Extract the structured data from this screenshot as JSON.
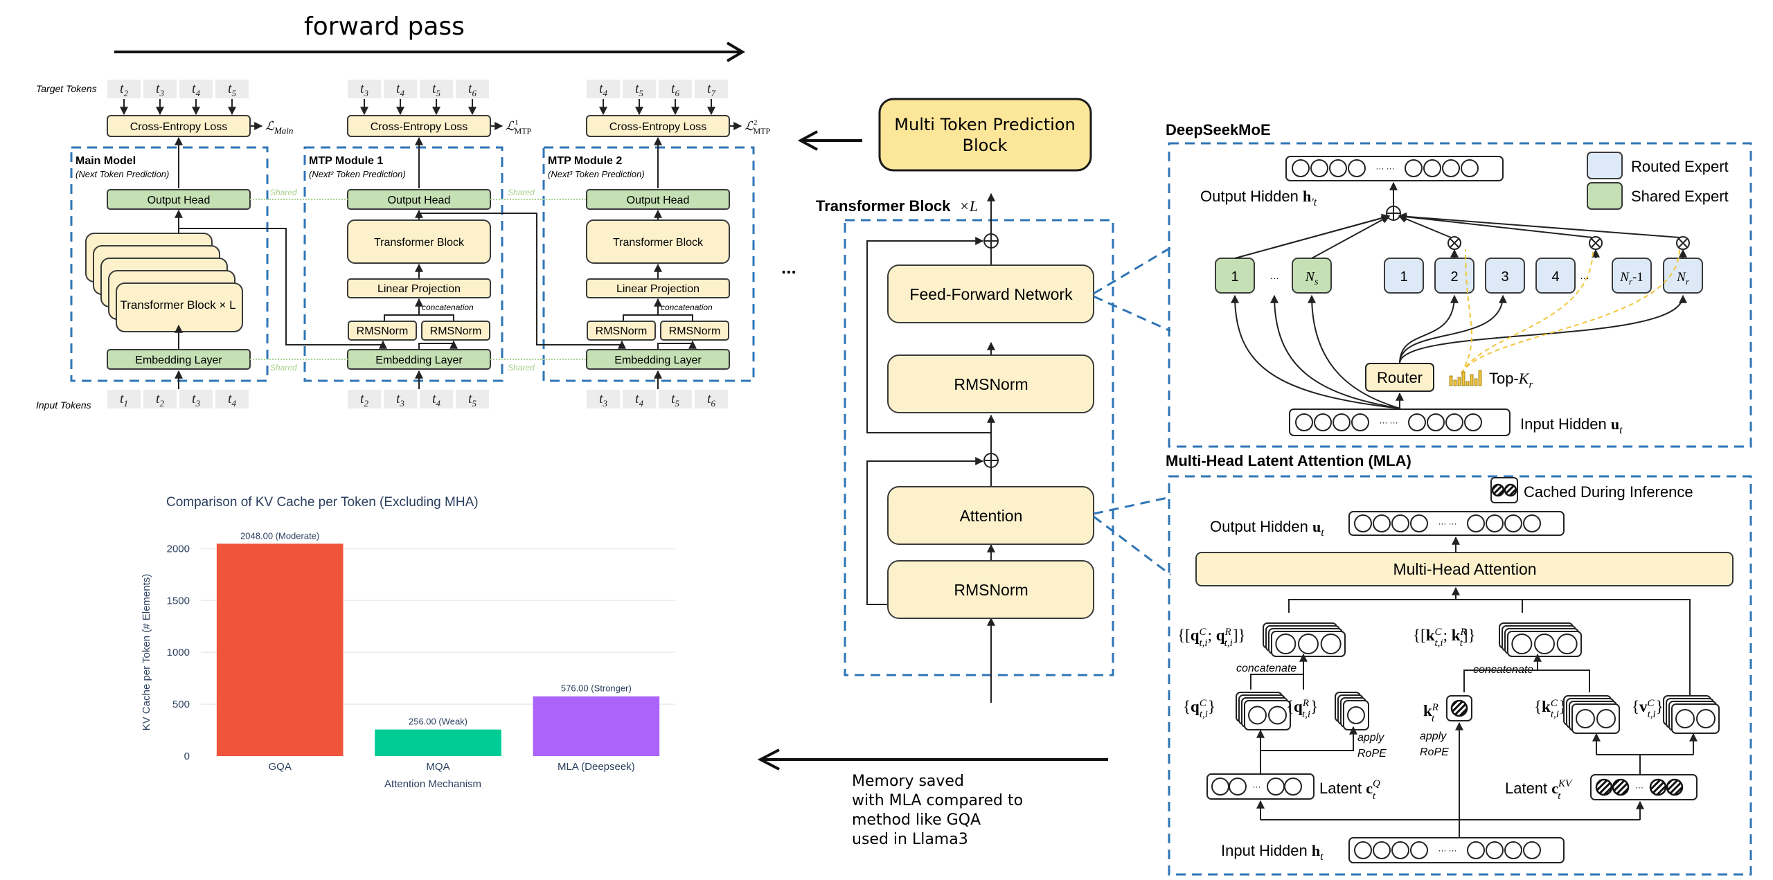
{
  "mtp": {
    "forward_pass": "forward pass",
    "target_tokens_label": "Target Tokens",
    "input_tokens_label": "Input Tokens",
    "shared_label": "Shared",
    "ellipsis": "...",
    "modules": [
      {
        "title": "Main Model",
        "subtitle": "(Next Token Prediction)",
        "loss_label": "Cross-Entropy Loss",
        "loss_symbol": "ℒ",
        "loss_sub": "Main",
        "loss_sup": "",
        "output_head": "Output Head",
        "block": "Transformer Block × L",
        "embedding": "Embedding Layer",
        "target_tokens": [
          "t2",
          "t3",
          "t4",
          "t5"
        ],
        "input_tokens": [
          "t1",
          "t2",
          "t3",
          "t4"
        ]
      },
      {
        "title": "MTP Module 1",
        "subtitle": "(Next² Token Prediction)",
        "loss_label": "Cross-Entropy Loss",
        "loss_symbol": "ℒ",
        "loss_sub": "MTP",
        "loss_sup": "1",
        "output_head": "Output Head",
        "block": "Transformer Block",
        "linear": "Linear Projection",
        "concat": "concatenation",
        "rms1": "RMSNorm",
        "rms2": "RMSNorm",
        "embedding": "Embedding Layer",
        "target_tokens": [
          "t3",
          "t4",
          "t5",
          "t6"
        ],
        "input_tokens": [
          "t2",
          "t3",
          "t4",
          "t5"
        ]
      },
      {
        "title": "MTP Module 2",
        "subtitle": "(Next³ Token Prediction)",
        "loss_label": "Cross-Entropy Loss",
        "loss_symbol": "ℒ",
        "loss_sub": "MTP",
        "loss_sup": "2",
        "output_head": "Output Head",
        "block": "Transformer Block",
        "linear": "Linear Projection",
        "concat": "concatenation",
        "rms1": "RMSNorm",
        "rms2": "RMSNorm",
        "embedding": "Embedding Layer",
        "target_tokens": [
          "t4",
          "t5",
          "t6",
          "t7"
        ],
        "input_tokens": [
          "t3",
          "t4",
          "t5",
          "t6"
        ]
      }
    ]
  },
  "annotations": {
    "mtp_block_line1": "Multi Token Prediction",
    "mtp_block_line2": "Block",
    "memory_note": [
      "Memory saved",
      "with MLA compared to",
      "method like GQA",
      "used in Llama3"
    ]
  },
  "transformer": {
    "title": "Transformer Block",
    "title_suffix": "×L",
    "ffn": "Feed-Forward Network",
    "rms_top": "RMSNorm",
    "attention": "Attention",
    "rms_bottom": "RMSNorm"
  },
  "moe": {
    "title": "DeepSeekMoE",
    "output_hidden": "Output Hidden h′t",
    "input_hidden": "Input Hidden ut",
    "legend_routed": "Routed Expert",
    "legend_shared": "Shared Expert",
    "router": "Router",
    "topk": "Top-Kr",
    "shared_experts": [
      "1",
      "…",
      "Ns"
    ],
    "routed_experts": [
      "1",
      "2",
      "3",
      "4",
      "…",
      "Nr-1",
      "Nr"
    ],
    "colors": {
      "routed": "#dde9f7",
      "shared": "#c5e0b4",
      "router": "#fdf1cc",
      "topk_bars": "#f2c53d"
    }
  },
  "mla": {
    "title": "Multi-Head Latent Attention (MLA)",
    "cached_legend": "Cached During Inference",
    "output_hidden": "Output Hidden ut",
    "mha": "Multi-Head Attention",
    "q_concat": "{[qCt,i; qRt,i]}",
    "k_concat": "{[kCt,i; kRt]}",
    "concatenate": "concatenate",
    "qc": "{qCt,i}",
    "qr": "{qRt,i}",
    "kr": "kRt",
    "kc": "{kCt,i}",
    "vc": "{vCt,i}",
    "apply_rope": [
      "apply",
      "RoPE"
    ],
    "latent_q": "Latent cQt",
    "latent_kv": "Latent cKVt",
    "input_hidden": "Input Hidden ht"
  },
  "chart_data": {
    "type": "bar",
    "title": "Comparison of KV Cache per Token (Excluding MHA)",
    "xlabel": "Attention Mechanism",
    "ylabel": "KV Cache per Token (# Elements)",
    "categories": [
      "GQA",
      "MQA",
      "MLA (Deepseek)"
    ],
    "values": [
      2048,
      256,
      576
    ],
    "data_labels": [
      "2048.00 (Moderate)",
      "256.00 (Weak)",
      "576.00 (Stronger)"
    ],
    "colors": [
      "#ef553b",
      "#00cc96",
      "#ab63fa"
    ],
    "yticks": [
      0,
      500,
      1000,
      1500,
      2000
    ],
    "ylim": [
      0,
      2130
    ],
    "grid": true,
    "legend": "none"
  }
}
